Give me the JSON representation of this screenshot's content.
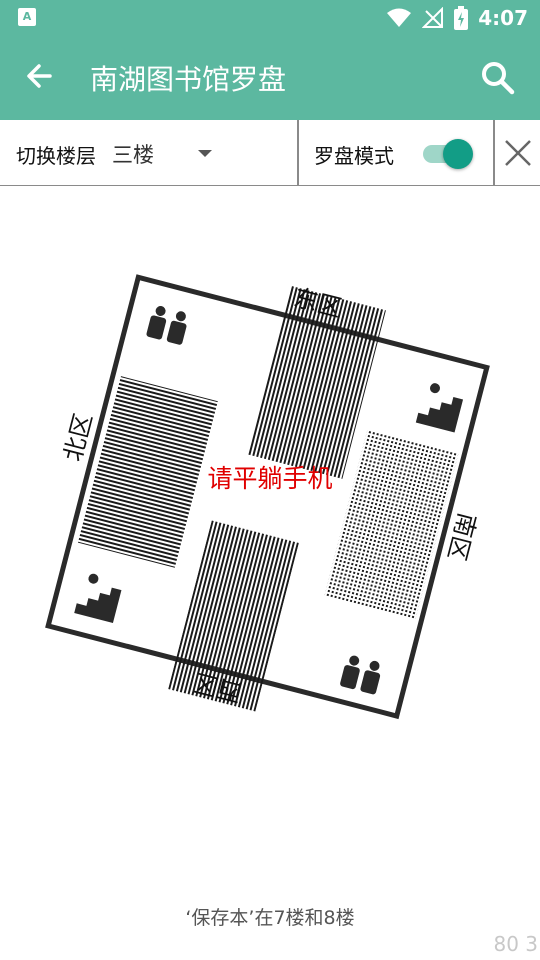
{
  "status_bar": {
    "time": "4:07",
    "notification_icon": "text-a-icon",
    "icons": [
      "wifi-icon",
      "signal-icon",
      "battery-charging-icon"
    ]
  },
  "app_bar": {
    "title": "南湖图书馆罗盘",
    "back_icon": "arrow-back-icon",
    "search_icon": "search-icon"
  },
  "toolbar": {
    "floor_label": "切换楼层",
    "floor_value": "三楼",
    "compass_mode_label": "罗盘模式",
    "compass_mode_on": true,
    "close_icon": "close-icon"
  },
  "compass": {
    "north": "北区",
    "east": "东区",
    "south": "南区",
    "west": "西区",
    "center_text": "请平躺手机",
    "center_color": "#e00000"
  },
  "footer": {
    "note": "‘保存本’在7楼和8楼",
    "corner_number": "80 3"
  },
  "colors": {
    "primary": "#5cb8a0",
    "switch_thumb": "#129d86",
    "switch_track": "#9fd6c8"
  }
}
